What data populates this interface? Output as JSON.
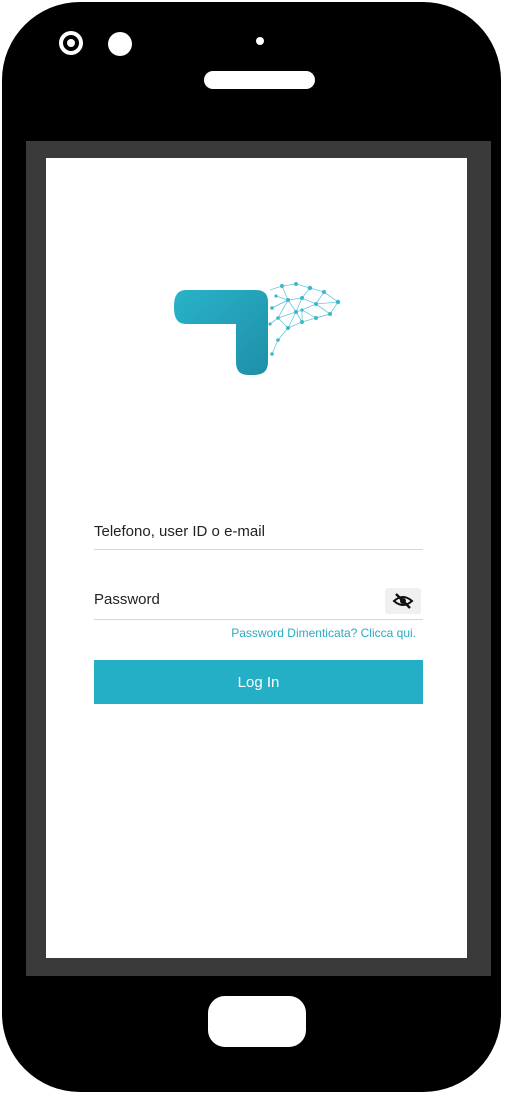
{
  "login": {
    "username_placeholder": "Telefono, user ID o e-mail",
    "password_placeholder": "Password",
    "forgot_password_link": "Password Dimenticata? Clicca qui.",
    "login_button": "Log In"
  },
  "icons": {
    "password_toggle": "eye-slash-icon",
    "logo": "app-logo"
  },
  "colors": {
    "brand_teal": "#24afc6",
    "link_teal": "#2aaac2",
    "phone_body": "#000000"
  }
}
